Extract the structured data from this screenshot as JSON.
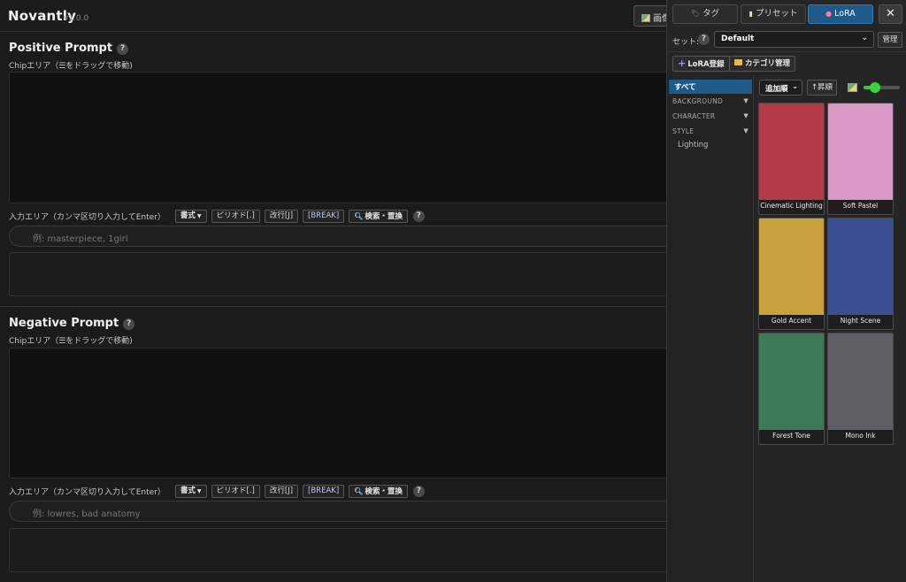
{
  "app": {
    "title": "Novantly",
    "version": "v1.0.0",
    "image_button_label": "画像"
  },
  "positive": {
    "title": "Positive Prompt",
    "help": "?",
    "chip_label": "Chipエリア（☰をドラッグで移動)",
    "input_label": "入力エリア（カンマ区切り入力してEnter）",
    "placeholder": "例: masterpiece, 1girl"
  },
  "negative": {
    "title": "Negative Prompt",
    "help": "?",
    "chip_label": "Chipエリア（☰をドラッグで移動)",
    "input_label": "入力エリア（カンマ区切り入力してEnter）",
    "placeholder": "例: lowres, bad anatomy"
  },
  "toolbar": {
    "format": "書式",
    "period": "ピリオド[.]",
    "newline": "改行[J]",
    "break": "[BREAK]",
    "search_replace": "検索・置換",
    "help": "?"
  },
  "panel": {
    "tabs": [
      {
        "label": "タグ",
        "icon": "tag-icon"
      },
      {
        "label": "プリセット",
        "icon": "clipboard-icon"
      },
      {
        "label": "LoRA",
        "icon": "palette-icon",
        "active": true
      }
    ],
    "close": "✕",
    "set_label": "セット:",
    "set_help": "?",
    "set_value": "Default",
    "manage": "管理",
    "lora_register": "LoRA登録",
    "category_manage": "カテゴリ管理",
    "categories": {
      "all": "すべて",
      "groups": [
        "BACKGROUND",
        "CHARACTER",
        "STYLE"
      ],
      "style_items": [
        "Lighting"
      ]
    },
    "sort_value": "追加順",
    "order": "↑昇順",
    "thumb_size_level": 0.25,
    "cards": [
      {
        "label": "Cinematic Lighting",
        "color": "#b33a48"
      },
      {
        "label": "Soft Pastel",
        "color": "#d998c6"
      },
      {
        "label": "Gold Accent",
        "color": "#c9a13c"
      },
      {
        "label": "Night Scene",
        "color": "#3b4e91"
      },
      {
        "label": "Forest Tone",
        "color": "#3d7a55"
      },
      {
        "label": "Mono Ink",
        "color": "#5f5e64"
      }
    ]
  }
}
